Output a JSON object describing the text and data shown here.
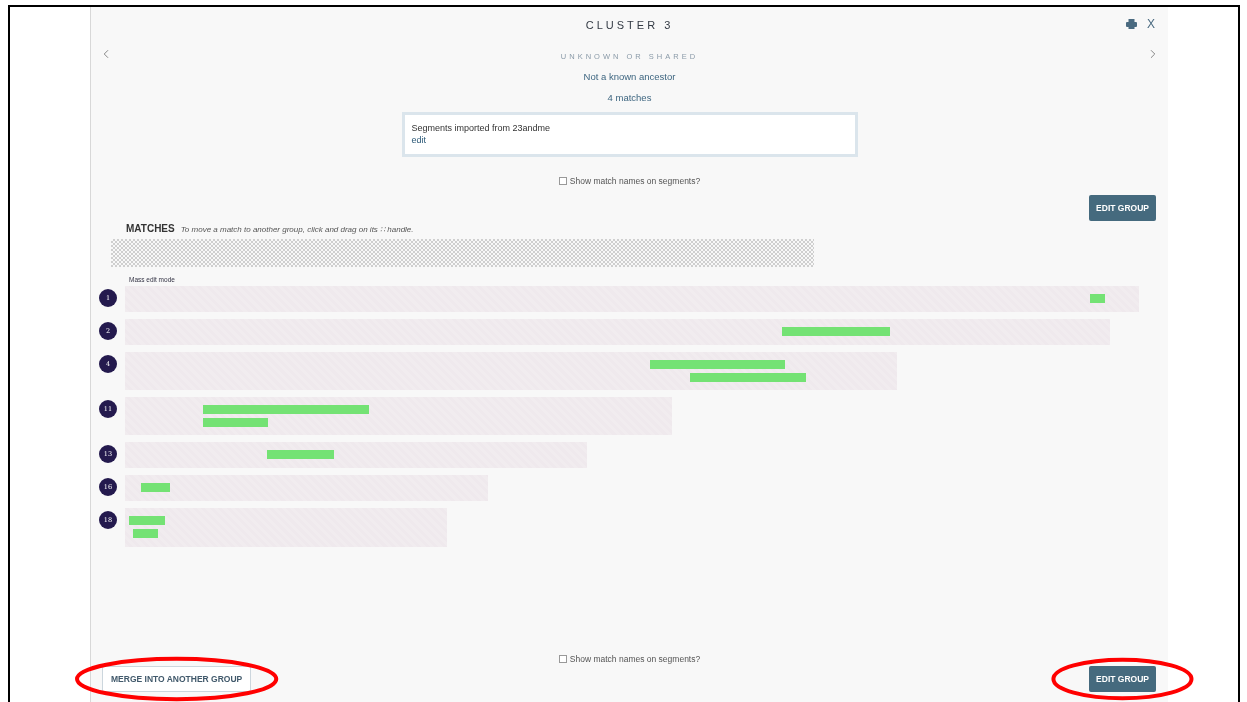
{
  "header": {
    "title": "CLUSTER 3",
    "close": "X",
    "subtitle": "UNKNOWN OR SHARED",
    "description": "Not a known ancestor",
    "match_count": "4 matches"
  },
  "notes": {
    "text": "Segments imported from 23andme",
    "link": "edit"
  },
  "show_names_top": {
    "label": "Show match names on segments?",
    "checked": false
  },
  "edit_group_top": {
    "label": "EDIT GROUP"
  },
  "matches": {
    "heading": "MATCHES",
    "hint": "To move a match to another group, click and drag on its ∷ handle.",
    "mass_edit": "Mass edit mode",
    "rows": [
      {
        "number": "1"
      },
      {
        "number": "2"
      },
      {
        "number": "4"
      },
      {
        "number": "11"
      },
      {
        "number": "13"
      },
      {
        "number": "16"
      },
      {
        "number": "18"
      }
    ]
  },
  "show_names_bottom": {
    "label": "Show match names on segments?",
    "checked": false
  },
  "merge_button": {
    "label": "MERGE INTO ANOTHER GROUP",
    "circled": true
  },
  "edit_group_bottom": {
    "label": "EDIT GROUP",
    "circled": true
  }
}
